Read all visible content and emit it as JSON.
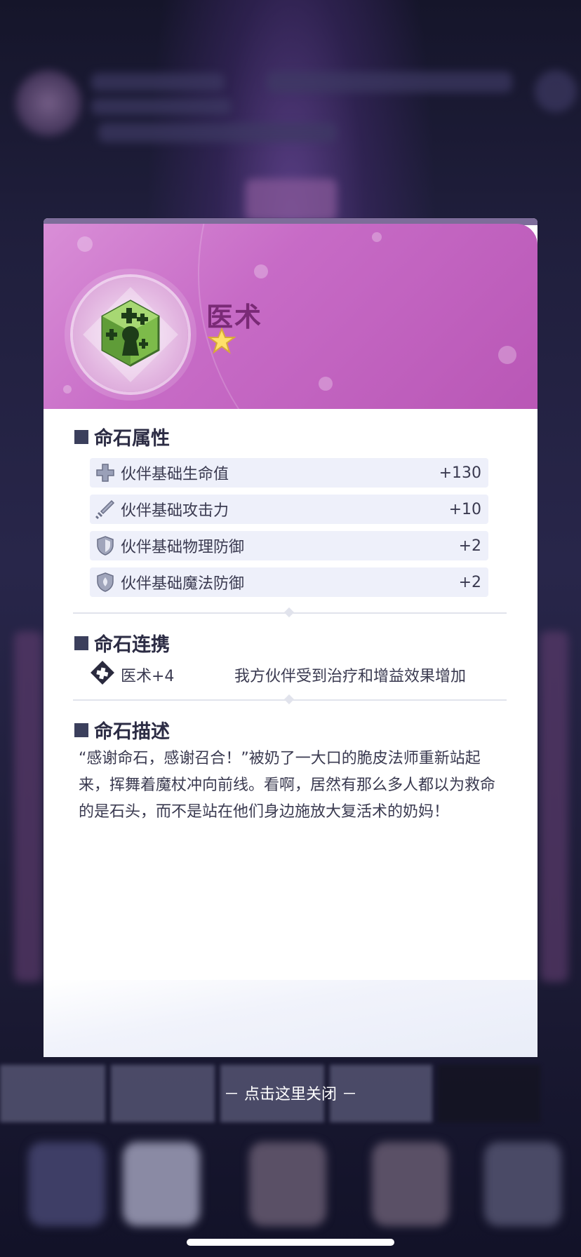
{
  "item": {
    "name": "医术",
    "stars": "★"
  },
  "attributes": {
    "title": "命石属性",
    "rows": [
      {
        "name": "伙伴基础生命值",
        "value": "+130",
        "icon": "health-cross-icon"
      },
      {
        "name": "伙伴基础攻击力",
        "value": "+10",
        "icon": "sword-icon"
      },
      {
        "name": "伙伴基础物理防御",
        "value": "+2",
        "icon": "shield-icon"
      },
      {
        "name": "伙伴基础魔法防御",
        "value": "+2",
        "icon": "magic-shield-icon"
      }
    ]
  },
  "link": {
    "title": "命石连携",
    "name": "医术+4",
    "effect": "我方伙伴受到治疗和增益效果增加"
  },
  "description": {
    "title": "命石描述",
    "text": "“感谢命石，感谢召合！”被奶了一大口的脆皮法师重新站起来，挥舞着魔杖冲向前线。看啊，居然有那么多人都以为救命的是石头，而不是站在他们身边施放大复活术的奶妈！"
  },
  "close_hint": "－ 点击这里关闭 －",
  "colors": {
    "header": "#c76bc6",
    "title": "#7a2a76",
    "row_bg": "#eef0fa"
  }
}
